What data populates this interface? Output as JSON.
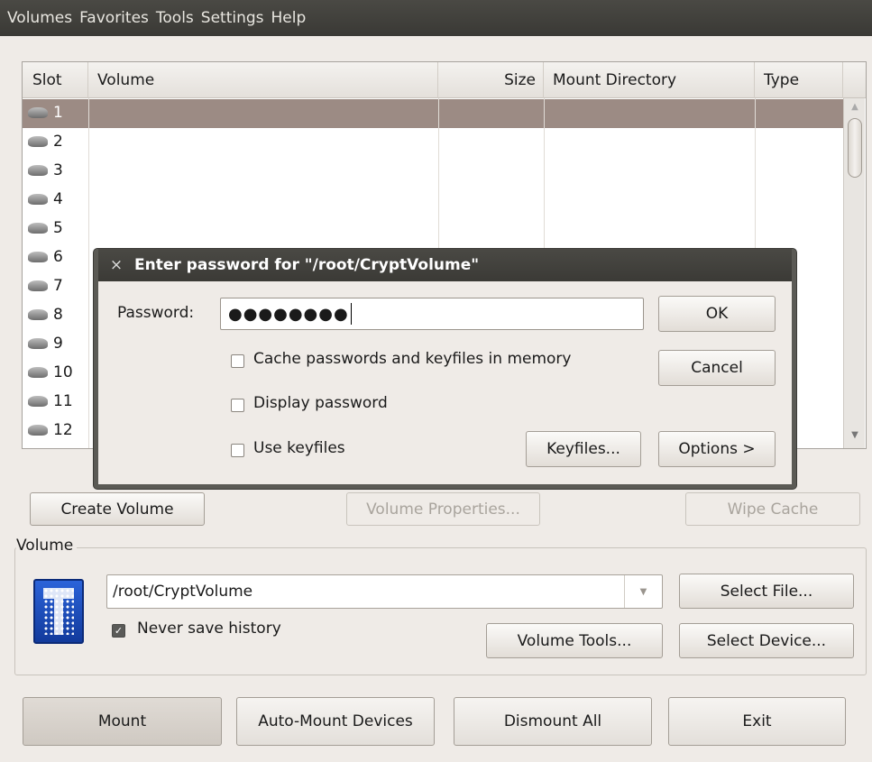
{
  "menubar": {
    "items": [
      "Volumes",
      "Favorites",
      "Tools",
      "Settings",
      "Help"
    ]
  },
  "volume_list": {
    "columns": [
      "Slot",
      "Volume",
      "Size",
      "Mount Directory",
      "Type"
    ],
    "slots": [
      "1",
      "2",
      "3",
      "4",
      "5",
      "6",
      "7",
      "8",
      "9",
      "10",
      "11",
      "12"
    ],
    "selected_slot": "1"
  },
  "buttons": {
    "create_volume": "Create Volume",
    "volume_properties": "Volume Properties...",
    "wipe_cache": "Wipe Cache",
    "select_file": "Select File...",
    "volume_tools": "Volume Tools...",
    "select_device": "Select Device...",
    "mount": "Mount",
    "auto_mount": "Auto-Mount Devices",
    "dismount_all": "Dismount All",
    "exit": "Exit"
  },
  "volume_group": {
    "label": "Volume",
    "path": "/root/CryptVolume",
    "never_save_history": "Never save history",
    "never_save_history_checked": true
  },
  "dialog": {
    "title": "Enter password for \"/root/CryptVolume\"",
    "password_label": "Password:",
    "password_value": "●●●●●●●●",
    "cache_label": "Cache passwords and keyfiles in memory",
    "display_label": "Display password",
    "keyfiles_label": "Use keyfiles",
    "ok": "OK",
    "cancel": "Cancel",
    "keyfiles_button": "Keyfiles...",
    "options_button": "Options >"
  }
}
